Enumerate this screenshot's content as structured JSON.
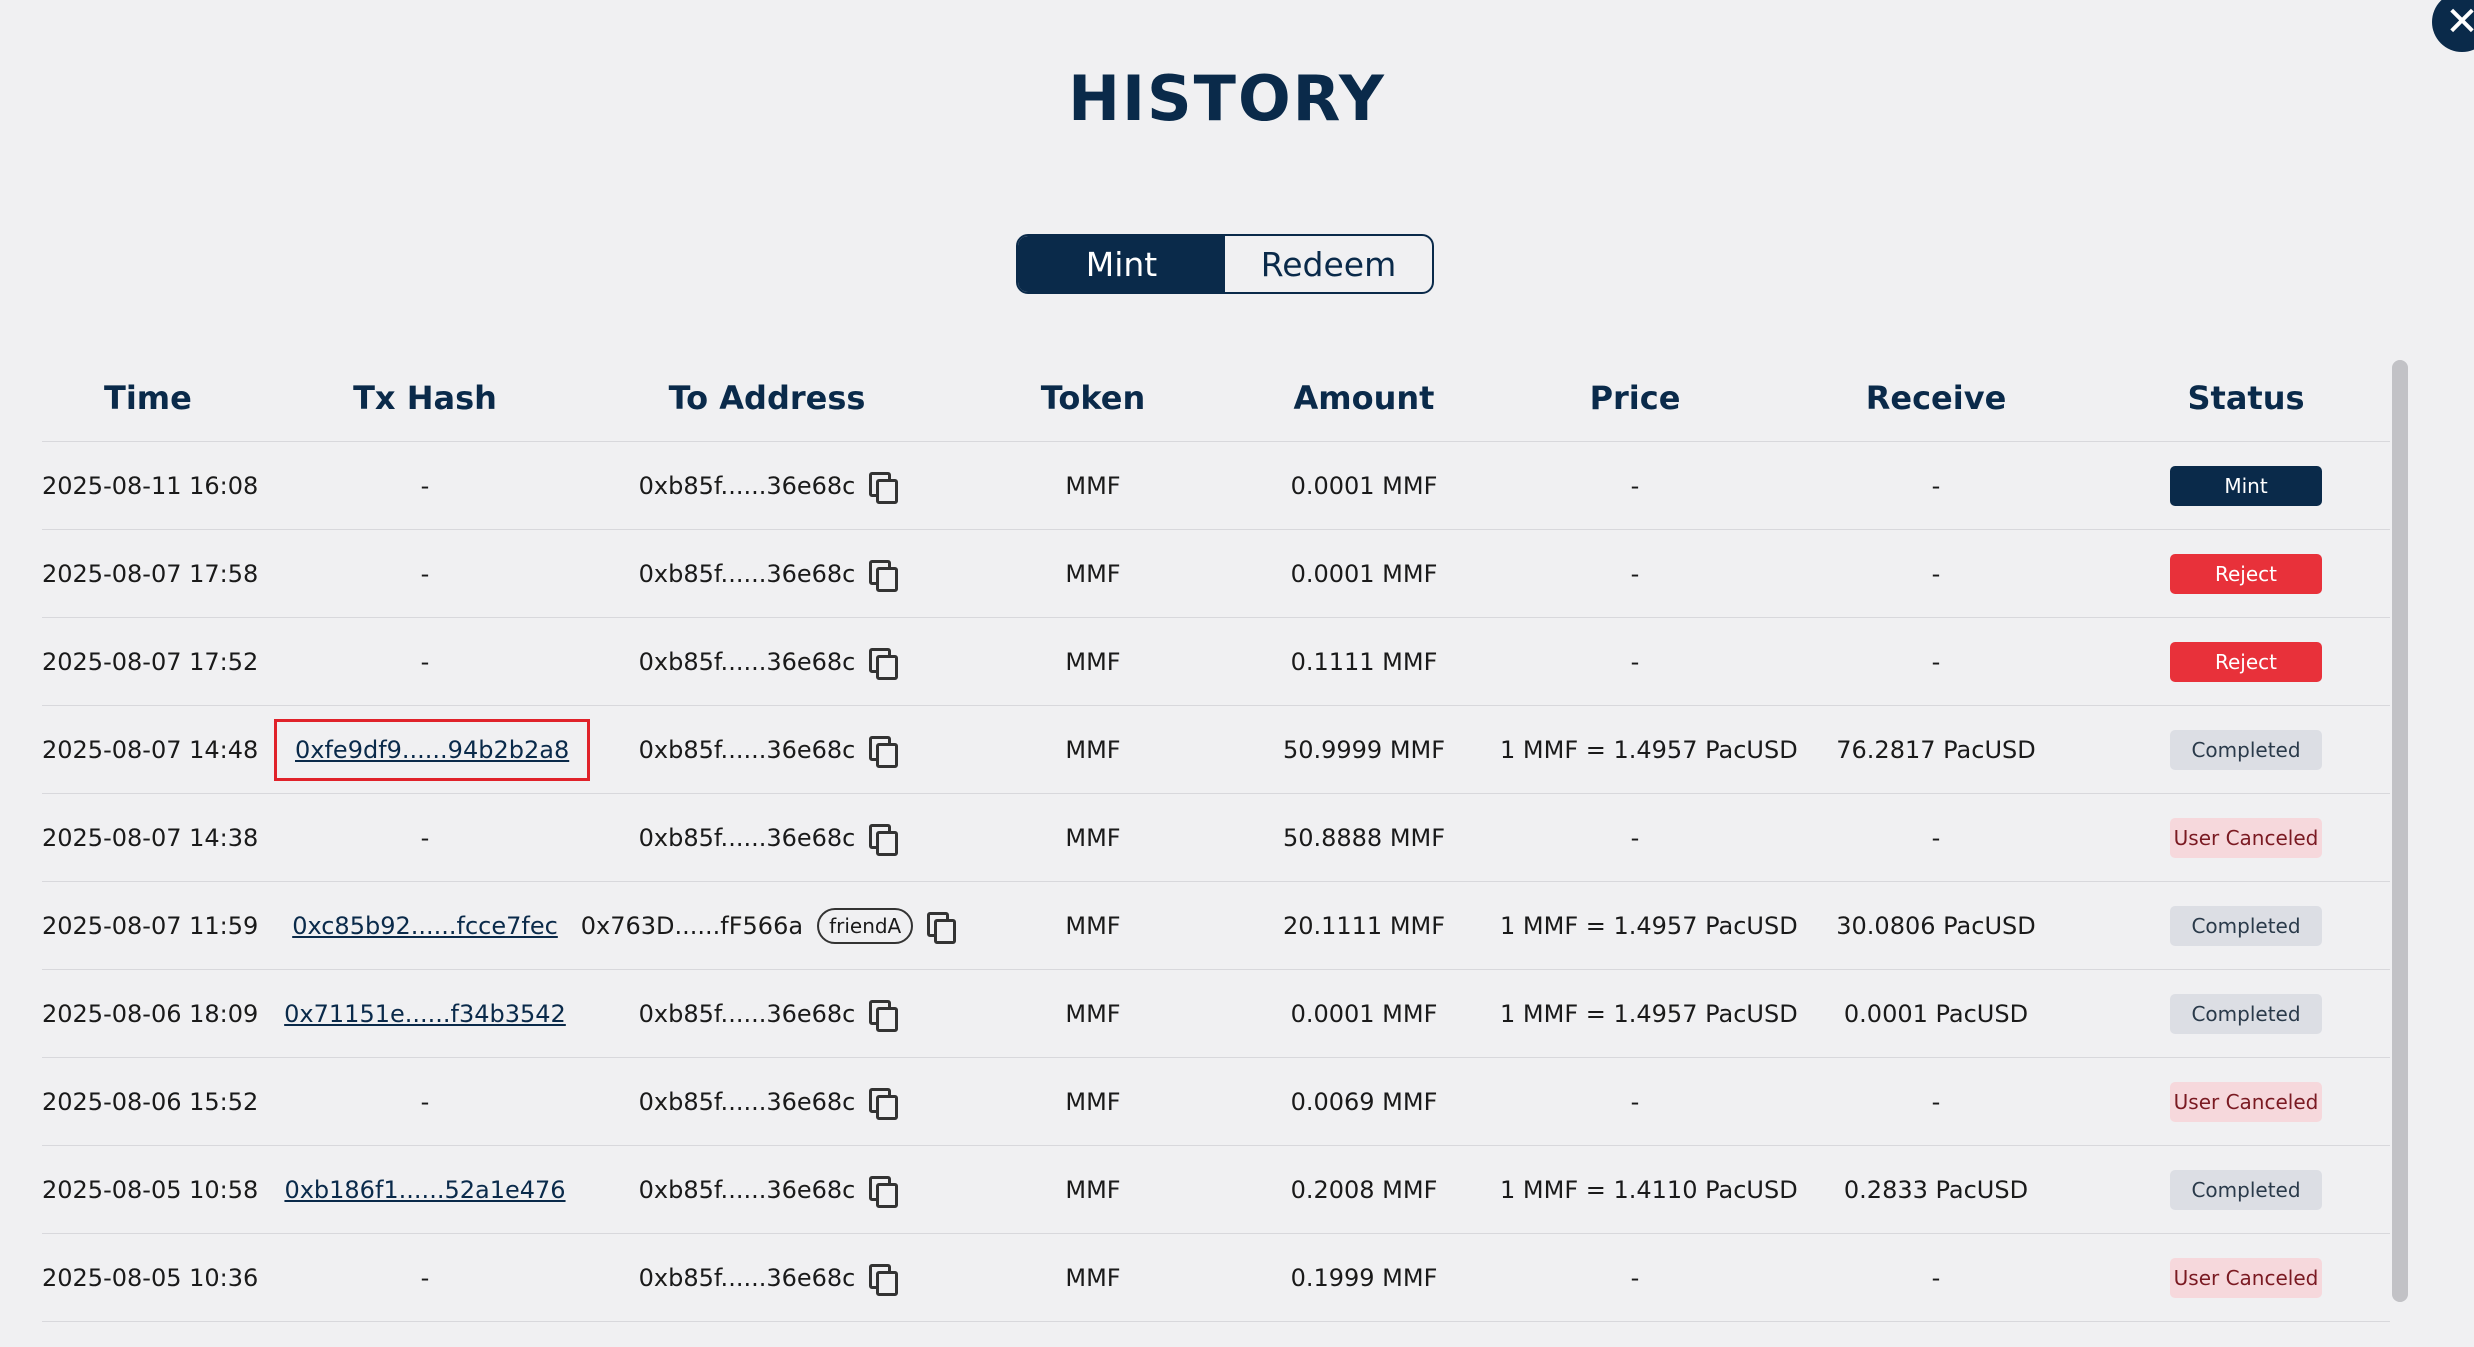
{
  "close_icon_glyph": "✕",
  "title": "HISTORY",
  "tabs": {
    "mint": "Mint",
    "redeem": "Redeem"
  },
  "columns": [
    "Time",
    "Tx Hash",
    "To Address",
    "Token",
    "Amount",
    "Price",
    "Receive",
    "Status"
  ],
  "rows": [
    {
      "time": "2025-08-11 16:08",
      "tx_hash": "-",
      "to_address": "0xb85f......36e68c",
      "tag": "",
      "token": "MMF",
      "amount": "0.0001 MMF",
      "price": "-",
      "receive": "-",
      "status": "Mint",
      "status_type": "mint"
    },
    {
      "time": "2025-08-07 17:58",
      "tx_hash": "-",
      "to_address": "0xb85f......36e68c",
      "tag": "",
      "token": "MMF",
      "amount": "0.0001 MMF",
      "price": "-",
      "receive": "-",
      "status": "Reject",
      "status_type": "reject"
    },
    {
      "time": "2025-08-07 17:52",
      "tx_hash": "-",
      "to_address": "0xb85f......36e68c",
      "tag": "",
      "token": "MMF",
      "amount": "0.1111 MMF",
      "price": "-",
      "receive": "-",
      "status": "Reject",
      "status_type": "reject"
    },
    {
      "time": "2025-08-07 14:48",
      "tx_hash": "0xfe9df9......94b2b2a8",
      "highlight": true,
      "to_address": "0xb85f......36e68c",
      "tag": "",
      "token": "MMF",
      "amount": "50.9999 MMF",
      "price": "1 MMF = 1.4957 PacUSD",
      "receive": "76.2817 PacUSD",
      "status": "Completed",
      "status_type": "completed"
    },
    {
      "time": "2025-08-07 14:38",
      "tx_hash": "-",
      "to_address": "0xb85f......36e68c",
      "tag": "",
      "token": "MMF",
      "amount": "50.8888 MMF",
      "price": "-",
      "receive": "-",
      "status": "User Canceled",
      "status_type": "canceled"
    },
    {
      "time": "2025-08-07 11:59",
      "tx_hash": "0xc85b92......fcce7fec",
      "to_address": "0x763D......fF566a",
      "tag": "friendA",
      "token": "MMF",
      "amount": "20.1111 MMF",
      "price": "1 MMF = 1.4957 PacUSD",
      "receive": "30.0806 PacUSD",
      "status": "Completed",
      "status_type": "completed"
    },
    {
      "time": "2025-08-06 18:09",
      "tx_hash": "0x71151e......f34b3542",
      "to_address": "0xb85f......36e68c",
      "tag": "",
      "token": "MMF",
      "amount": "0.0001 MMF",
      "price": "1 MMF = 1.4957 PacUSD",
      "receive": "0.0001 PacUSD",
      "status": "Completed",
      "status_type": "completed"
    },
    {
      "time": "2025-08-06 15:52",
      "tx_hash": "-",
      "to_address": "0xb85f......36e68c",
      "tag": "",
      "token": "MMF",
      "amount": "0.0069 MMF",
      "price": "-",
      "receive": "-",
      "status": "User Canceled",
      "status_type": "canceled"
    },
    {
      "time": "2025-08-05 10:58",
      "tx_hash": "0xb186f1......52a1e476",
      "to_address": "0xb85f......36e68c",
      "tag": "",
      "token": "MMF",
      "amount": "0.2008 MMF",
      "price": "1 MMF = 1.4110 PacUSD",
      "receive": "0.2833 PacUSD",
      "status": "Completed",
      "status_type": "completed"
    },
    {
      "time": "2025-08-05 10:36",
      "tx_hash": "-",
      "to_address": "0xb85f......36e68c",
      "tag": "",
      "token": "MMF",
      "amount": "0.1999 MMF",
      "price": "-",
      "receive": "-",
      "status": "User Canceled",
      "status_type": "canceled"
    }
  ]
}
